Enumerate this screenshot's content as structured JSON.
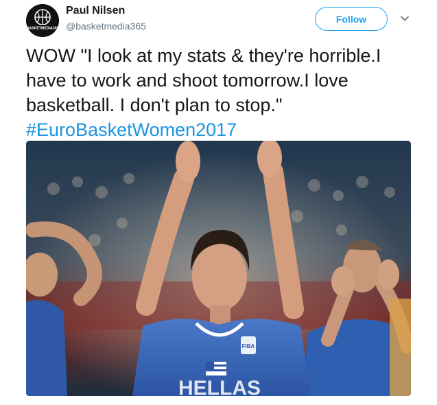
{
  "author": {
    "display_name": "Paul Nilsen",
    "handle": "@basketmedia365",
    "avatar_text": "BASKETMEDIA365"
  },
  "follow_label": "Follow",
  "tweet": {
    "text": "WOW \"I look at my stats & they're horrible.I have to work and shoot tomorrow.I love basketball. I don't plan to stop.\"",
    "hashtag": "#EuroBasketWomen2017"
  },
  "photo": {
    "jersey_text": "HELLAS",
    "badge_text": "FIBA"
  },
  "colors": {
    "accent": "#1da1f2",
    "hashtag": "#1b95e0",
    "text": "#14171a",
    "secondary": "#657786",
    "jersey": "#3a63b8"
  },
  "icons": {
    "caret": "chevron-down-icon"
  }
}
